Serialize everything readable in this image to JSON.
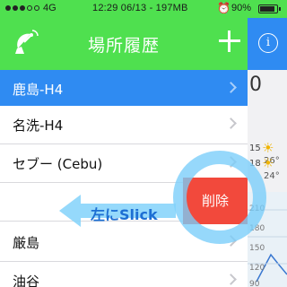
{
  "status_bar": {
    "network": "4G",
    "time": "12:29 06/13 - 197MB",
    "battery": "90%",
    "alarm_icon": "alarm-clock-icon"
  },
  "nav": {
    "title": "場所履歴",
    "left_icon": "satellite-dish-icon",
    "right_icon": "plus-icon"
  },
  "rows": [
    {
      "label": "鹿島-H4",
      "selected": true
    },
    {
      "label": "名洗-H4",
      "selected": false
    },
    {
      "label": "セブー (Cebu)",
      "selected": false
    },
    {
      "label": "",
      "selected": false
    },
    {
      "label": "厳島",
      "selected": false
    },
    {
      "label": "油谷",
      "selected": false
    }
  ],
  "delete_label": "削除",
  "hint_text": "左にSlick",
  "background_panel": {
    "digit": "0",
    "weather": [
      {
        "day": "15",
        "temp": "26°"
      },
      {
        "day": "18",
        "temp": "24°"
      }
    ],
    "ticks": [
      "210",
      "180",
      "150",
      "120",
      "90"
    ]
  },
  "colors": {
    "nav": "#4fe04f",
    "selected_row": "#2f8bf2",
    "delete": "#f2493c"
  }
}
